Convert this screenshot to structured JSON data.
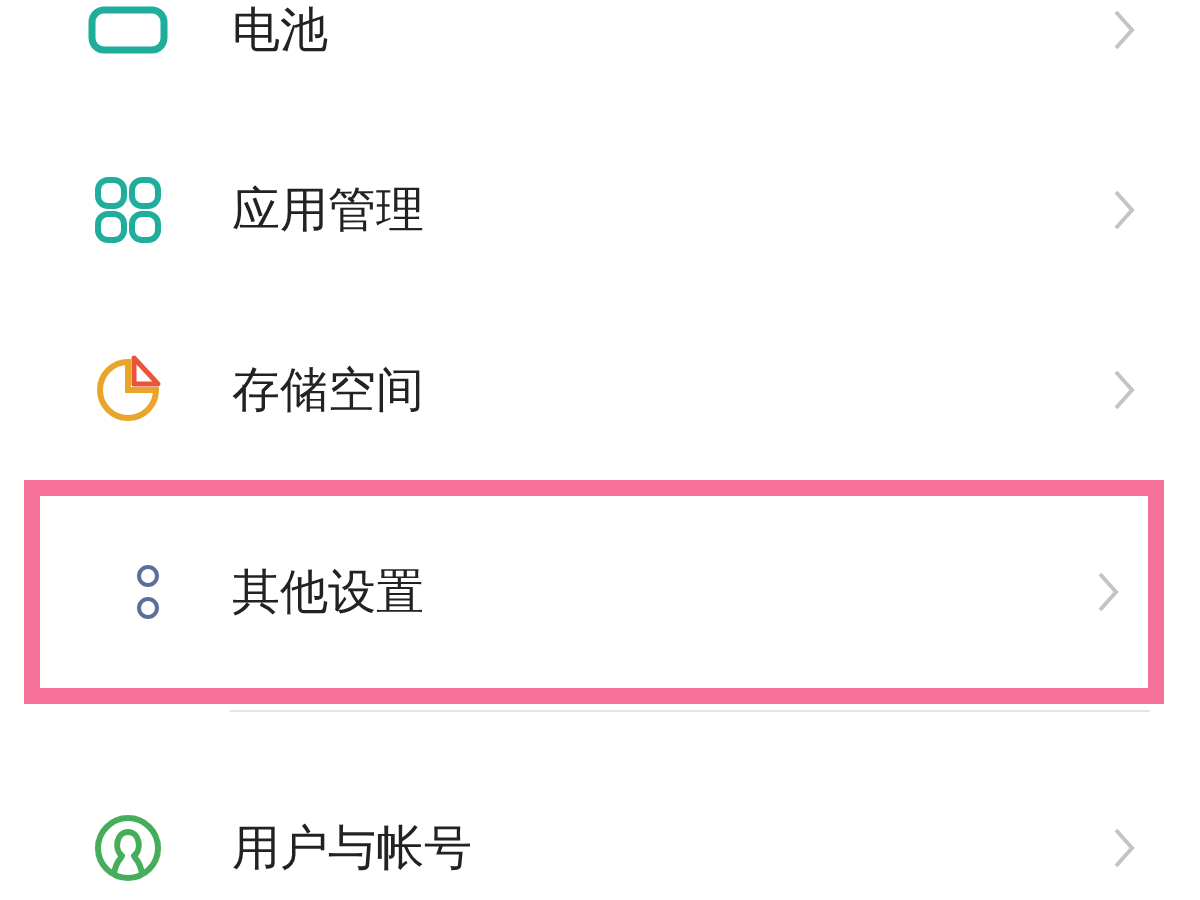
{
  "settings": {
    "groups": [
      {
        "items": [
          {
            "label": "电池",
            "highlighted": false
          },
          {
            "label": "应用管理",
            "highlighted": false
          },
          {
            "label": "存储空间",
            "highlighted": false
          },
          {
            "label": "其他设置",
            "highlighted": true
          }
        ]
      },
      {
        "items": [
          {
            "label": "用户与帐号",
            "highlighted": false
          }
        ]
      }
    ]
  }
}
